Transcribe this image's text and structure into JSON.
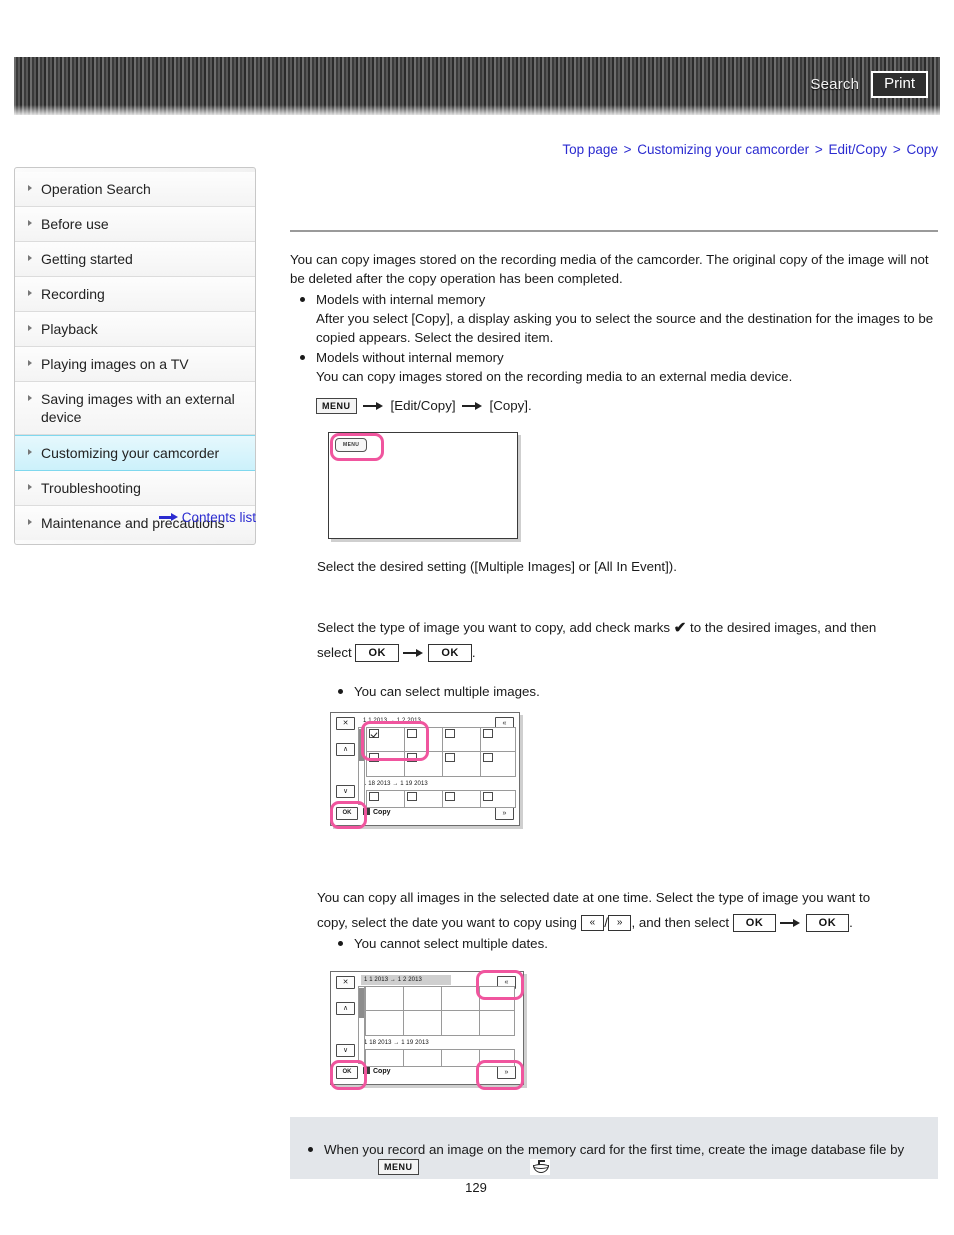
{
  "header": {
    "search_label": "Search",
    "print_label": "Print"
  },
  "breadcrumb": {
    "items": [
      "Top page",
      "Customizing your camcorder",
      "Edit/Copy",
      "Copy"
    ],
    "separator": ">"
  },
  "sidebar": {
    "items": [
      {
        "label": "Operation Search",
        "active": false
      },
      {
        "label": "Before use",
        "active": false
      },
      {
        "label": "Getting started",
        "active": false
      },
      {
        "label": "Recording",
        "active": false
      },
      {
        "label": "Playback",
        "active": false
      },
      {
        "label": "Playing images on a TV",
        "active": false
      },
      {
        "label": "Saving images with an external device",
        "active": false
      },
      {
        "label": "Customizing your camcorder",
        "active": true
      },
      {
        "label": "Troubleshooting",
        "active": false
      },
      {
        "label": "Maintenance and precautions",
        "active": false
      }
    ],
    "contents_list_label": "Contents list"
  },
  "main": {
    "intro_p1": "You can copy images stored on the recording media of the camcorder. The original copy of the image will not be deleted after the copy operation has been completed.",
    "bullet_internal_title": "Models with internal memory",
    "bullet_internal_body": "After you select [Copy], a display asking you to select the source and the destination for the images to be copied appears. Select the desired item.",
    "bullet_nointernal_title": "Models without internal memory",
    "bullet_nointernal_body": "You can copy images stored on the recording media to an external media device.",
    "menu_path": {
      "menu_label": "MENU",
      "step1": "[Edit/Copy]",
      "step2": "[Copy]."
    },
    "select_setting_text": "Select the desired setting ([Multiple Images] or [All In Event]).",
    "multiple_images": {
      "text_before_check": "Select the type of image you want to copy, add check marks",
      "check_glyph": "✔",
      "text_after_check": "to the desired images, and then",
      "select_word": "select",
      "ok_label": "OK",
      "period": "."
    },
    "note_multiple": "You can select multiple images.",
    "all_in_event": {
      "line1": "You can copy all images in the selected date at one time. Select the type of image you want to",
      "line2_a": "copy, select the date you want to copy using",
      "chev_up": "«",
      "slash": "/",
      "chev_down": "»",
      "line2_b": ", and then select",
      "ok_label": "OK",
      "period": "."
    },
    "note_dates": "You cannot select multiple dates."
  },
  "illustrations": {
    "illus1": {
      "menu_chip_label": "MENU"
    },
    "illus2": {
      "close_label": "✕",
      "up_label": "∧",
      "down_label": "∨",
      "page_up_label": "«",
      "page_down_label": "»",
      "ok_label": "OK",
      "date_top": "1 1 2013  → 1 2 2013",
      "date_bottom": "1 18 2013 → 1 19 2013",
      "copy_label": "Copy"
    },
    "illus3": {
      "close_label": "✕",
      "up_label": "∧",
      "down_label": "∨",
      "page_up_label": "«",
      "page_down_label": "»",
      "ok_label": "OK",
      "date_top": "1 1 2013 → 1 2 2013",
      "date_bottom": "1 18 2013 → 1 19 2013",
      "copy_label": "Copy"
    }
  },
  "note": {
    "text": "When you record an image on the memory card for the first time, create the image database file by",
    "menu_label": "MENU"
  },
  "page_number": "129",
  "colors": {
    "link": "#2b2bd0",
    "highlight_pink": "#f0559e",
    "active_sidebar": "#ccf1fb",
    "note_bg": "#e3e6ea"
  }
}
